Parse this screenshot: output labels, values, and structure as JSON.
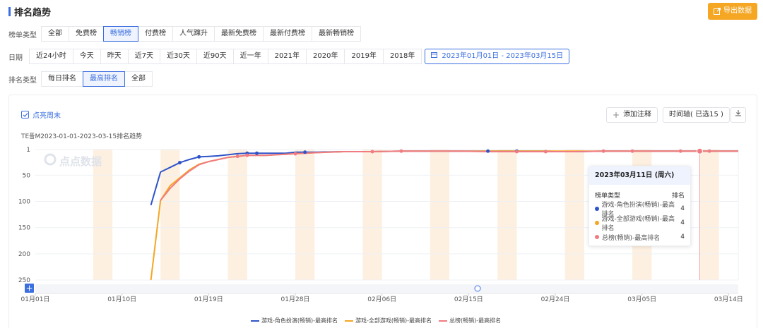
{
  "header": {
    "title": "排名趋势",
    "export_label": "导出数据"
  },
  "filters": {
    "list_type": {
      "label": "榜单类型",
      "options": [
        "全部",
        "免费榜",
        "畅销榜",
        "付费榜",
        "人气蹿升",
        "最新免费榜",
        "最新付费榜",
        "最新畅销榜"
      ],
      "selected": "畅销榜"
    },
    "date": {
      "label": "日期",
      "options": [
        "近24小时",
        "今天",
        "昨天",
        "近7天",
        "近30天",
        "近90天",
        "近一年",
        "2021年",
        "2020年",
        "2019年",
        "2018年"
      ],
      "range": "2023年01月01日 - 2023年03月15日"
    },
    "rank_type": {
      "label": "排名类型",
      "options": [
        "每日排名",
        "最高排名",
        "全部"
      ],
      "selected": "最高排名"
    }
  },
  "panel": {
    "weekend_checkbox": "点亮周末",
    "add_note": "添加注释",
    "timeline": "时间轴( 已选15 )",
    "subtitle": "TE플M2023-01-01-2023-03-15排名趋势",
    "watermark": "点点数据"
  },
  "tooltip": {
    "date": "2023年03月11日 (周六)",
    "col_type": "榜单类型",
    "col_rank": "排名",
    "rows": [
      {
        "label": "游戏-角色扮演(畅销)-最高排名",
        "value": "4",
        "color": "#2f54c9"
      },
      {
        "label": "游戏-全部游戏(畅销)-最高排名",
        "value": "4",
        "color": "#f5a623"
      },
      {
        "label": "总榜(畅销)-最高排名",
        "value": "4",
        "color": "#f07c82"
      }
    ]
  },
  "chart_data": {
    "type": "line",
    "x": [
      "01月01日",
      "01月10日",
      "01月19日",
      "01月28日",
      "02月06日",
      "02月15日",
      "02月24日",
      "03月05日",
      "03月14日"
    ],
    "x_range": [
      "2023-01-01",
      "2023-03-15"
    ],
    "ylim": [
      1,
      250
    ],
    "y_inverted": true,
    "yticks": [
      1,
      50,
      100,
      150,
      200,
      250
    ],
    "grid": true,
    "legend": "bottom",
    "series": [
      {
        "name": "游戏-角色扮演(畅销)-最高排名",
        "color": "#2f54c9",
        "points": [
          [
            "2023-01-13",
            107
          ],
          [
            "2023-01-14",
            44
          ],
          [
            "2023-01-15",
            35
          ],
          [
            "2023-01-16",
            26
          ],
          [
            "2023-01-17",
            20
          ],
          [
            "2023-01-18",
            15
          ],
          [
            "2023-01-19",
            14
          ],
          [
            "2023-01-20",
            13
          ],
          [
            "2023-01-21",
            11
          ],
          [
            "2023-01-22",
            9
          ],
          [
            "2023-01-23",
            8
          ],
          [
            "2023-01-24",
            8
          ],
          [
            "2023-01-25",
            8
          ],
          [
            "2023-01-26",
            8
          ],
          [
            "2023-01-27",
            8
          ],
          [
            "2023-01-28",
            6
          ],
          [
            "2023-01-29",
            6
          ],
          [
            "2023-01-30",
            6
          ],
          [
            "2023-02-02",
            5
          ],
          [
            "2023-02-05",
            5
          ],
          [
            "2023-02-08",
            4
          ],
          [
            "2023-02-11",
            4
          ],
          [
            "2023-02-14",
            4
          ],
          [
            "2023-02-17",
            4
          ],
          [
            "2023-02-20",
            4
          ],
          [
            "2023-02-23",
            4
          ],
          [
            "2023-02-26",
            5
          ],
          [
            "2023-03-01",
            4
          ],
          [
            "2023-03-04",
            4
          ],
          [
            "2023-03-06",
            4
          ],
          [
            "2023-03-09",
            4
          ],
          [
            "2023-03-11",
            4
          ],
          [
            "2023-03-12",
            4
          ],
          [
            "2023-03-15",
            4
          ]
        ]
      },
      {
        "name": "游戏-全部游戏(畅销)-最高排名",
        "color": "#f5a623",
        "points": [
          [
            "2023-01-13",
            250
          ],
          [
            "2023-01-14",
            98
          ],
          [
            "2023-01-15",
            70
          ],
          [
            "2023-01-16",
            55
          ],
          [
            "2023-01-17",
            40
          ],
          [
            "2023-01-18",
            29
          ],
          [
            "2023-01-19",
            24
          ],
          [
            "2023-01-20",
            20
          ],
          [
            "2023-01-21",
            16
          ],
          [
            "2023-01-22",
            14
          ],
          [
            "2023-01-23",
            12
          ],
          [
            "2023-01-24",
            12
          ],
          [
            "2023-01-25",
            12
          ],
          [
            "2023-01-26",
            11
          ],
          [
            "2023-01-27",
            10
          ],
          [
            "2023-01-28",
            9
          ],
          [
            "2023-01-29",
            8
          ],
          [
            "2023-01-30",
            7
          ],
          [
            "2023-02-02",
            5
          ],
          [
            "2023-02-05",
            5
          ],
          [
            "2023-02-08",
            4
          ],
          [
            "2023-02-11",
            4
          ],
          [
            "2023-02-14",
            4
          ],
          [
            "2023-02-17",
            4
          ],
          [
            "2023-02-20",
            4
          ],
          [
            "2023-02-23",
            4
          ],
          [
            "2023-02-26",
            4
          ],
          [
            "2023-03-01",
            4
          ],
          [
            "2023-03-04",
            4
          ],
          [
            "2023-03-06",
            4
          ],
          [
            "2023-03-09",
            4
          ],
          [
            "2023-03-11",
            4
          ],
          [
            "2023-03-12",
            4
          ],
          [
            "2023-03-15",
            4
          ]
        ]
      },
      {
        "name": "总榜(畅销)-最高排名",
        "color": "#f07c82",
        "points": [
          [
            "2023-01-14",
            98
          ],
          [
            "2023-01-15",
            75
          ],
          [
            "2023-01-16",
            57
          ],
          [
            "2023-01-17",
            42
          ],
          [
            "2023-01-18",
            30
          ],
          [
            "2023-01-19",
            24
          ],
          [
            "2023-01-20",
            20
          ],
          [
            "2023-01-21",
            16
          ],
          [
            "2023-01-22",
            14
          ],
          [
            "2023-01-23",
            12
          ],
          [
            "2023-01-24",
            12
          ],
          [
            "2023-01-25",
            12
          ],
          [
            "2023-01-26",
            11
          ],
          [
            "2023-01-27",
            10
          ],
          [
            "2023-01-28",
            9
          ],
          [
            "2023-01-29",
            8
          ],
          [
            "2023-01-30",
            7
          ],
          [
            "2023-02-02",
            5
          ],
          [
            "2023-02-05",
            5
          ],
          [
            "2023-02-08",
            4
          ],
          [
            "2023-02-11",
            4
          ],
          [
            "2023-02-14",
            4
          ],
          [
            "2023-02-17",
            5
          ],
          [
            "2023-02-20",
            5
          ],
          [
            "2023-02-23",
            5
          ],
          [
            "2023-02-26",
            5
          ],
          [
            "2023-03-01",
            4
          ],
          [
            "2023-03-04",
            4
          ],
          [
            "2023-03-06",
            4
          ],
          [
            "2023-03-09",
            4
          ],
          [
            "2023-03-11",
            4
          ],
          [
            "2023-03-12",
            4
          ],
          [
            "2023-03-15",
            4
          ]
        ]
      }
    ],
    "highlight_date": "2023-03-11"
  }
}
